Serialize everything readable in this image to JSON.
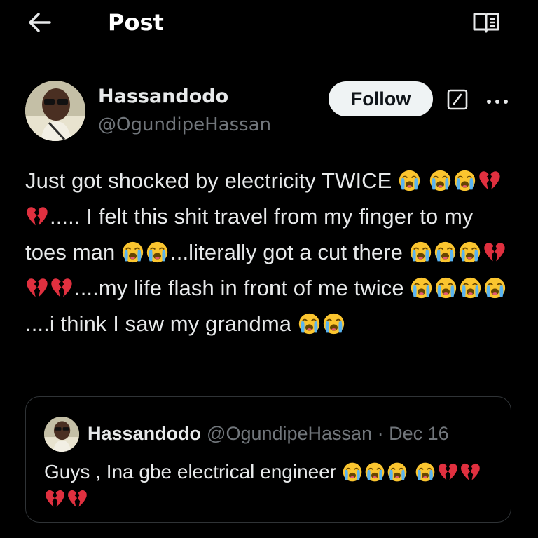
{
  "header": {
    "title": "Post",
    "back_icon": "arrow-left-icon",
    "reader_icon": "reader-mode-icon"
  },
  "author": {
    "name": "Hassandodo",
    "handle": "@OgundipeHassan",
    "follow_label": "Follow",
    "grok_icon": "grok-icon",
    "more_icon": "more-dots-icon"
  },
  "post": {
    "segments": [
      {
        "t": "Just got shocked by electricity TWICE "
      },
      {
        "e": "crying"
      },
      {
        "t": " "
      },
      {
        "e": "crying"
      },
      {
        "e": "crying"
      },
      {
        "e": "broken-heart"
      },
      {
        "e": "broken-heart"
      },
      {
        "t": "..... I felt this shit travel from my finger to my toes man "
      },
      {
        "e": "crying"
      },
      {
        "e": "crying"
      },
      {
        "t": "...literally got a cut there "
      },
      {
        "e": "crying"
      },
      {
        "e": "crying"
      },
      {
        "e": "crying"
      },
      {
        "e": "broken-heart"
      },
      {
        "e": "broken-heart"
      },
      {
        "e": "broken-heart"
      },
      {
        "t": "....my life flash in front of me twice "
      },
      {
        "e": "crying"
      },
      {
        "e": "crying"
      },
      {
        "e": "crying"
      },
      {
        "e": "crying"
      },
      {
        "t": "....i think I saw my grandma "
      },
      {
        "e": "crying"
      },
      {
        "e": "crying"
      }
    ]
  },
  "quote": {
    "name": "Hassandodo",
    "handle": "@OgundipeHassan",
    "separator": "·",
    "date": "Dec 16",
    "segments": [
      {
        "t": "Guys , Ina gbe electrical engineer "
      },
      {
        "e": "crying"
      },
      {
        "e": "crying"
      },
      {
        "e": "crying"
      },
      {
        "t": " "
      },
      {
        "e": "crying"
      },
      {
        "e": "broken-heart"
      },
      {
        "e": "broken-heart"
      },
      {
        "e": "broken-heart"
      },
      {
        "e": "broken-heart"
      }
    ]
  },
  "colors": {
    "background": "#000000",
    "text": "#e7e9ea",
    "secondary_text": "#71767b",
    "follow_bg": "#eff3f4",
    "border": "#2f3336",
    "emoji_face": "#fbc52f",
    "emoji_tears": "#5ab4f0",
    "broken_heart": "#e0303f"
  }
}
